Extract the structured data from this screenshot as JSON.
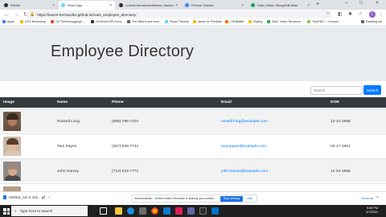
{
  "browser": {
    "tabs": [
      {
        "title": "GitHub",
        "color": "#24292e"
      },
      {
        "title": "React App",
        "color": "#61dafb"
      },
      {
        "title": "Lucidd-Hernandez/fitness_tracker",
        "color": "#24292e"
      },
      {
        "title": "Fitness Tracker",
        "color": "#4285f4"
      },
      {
        "title": "Data | Atlas: MongoDB Atlas",
        "color": "#13aa52"
      }
    ],
    "active_tab_index": 1,
    "new_tab_icon": "+",
    "url": "https://lusom-hernandez.github.io/react_employee_directory/",
    "bookmarks": [
      {
        "label": "Apps",
        "color": "#4285f4"
      },
      {
        "label": "UCF Bootcamp",
        "color": "#fbbc04"
      },
      {
        "label": "C# TheDebuggingC…",
        "color": "#ea4335"
      },
      {
        "label": "DevDocs API Docu…",
        "color": "#333333"
      },
      {
        "label": "The Why's and How…",
        "color": "#5f6368"
      },
      {
        "label": "React Tutorial",
        "color": "#61dafb"
      },
      {
        "label": "Ideas for Portfolio",
        "color": "#fbbc04"
      },
      {
        "label": "CSSBattle",
        "color": "#ff6d00"
      },
      {
        "label": "Styling",
        "color": "#fbbc04"
      },
      {
        "label": "WAC Video Structure",
        "color": "#34a853"
      },
      {
        "label": "TinyPNG – Compre…",
        "color": "#8bc34a"
      },
      {
        "label": "Reading list",
        "color": "#5f6368"
      }
    ],
    "profile_initial": "L"
  },
  "page": {
    "title": "Employee Directory",
    "search": {
      "placeholder": "Search",
      "value": ""
    },
    "search_button": "Search",
    "columns": [
      "Image",
      "Name",
      "Phone",
      "Email",
      "DOB"
    ],
    "employees": [
      {
        "name": "Russell Long",
        "phone": "(059)-785-7102",
        "email": "russell.long@example.com",
        "dob": "12-12-1958",
        "skin": "#b07a5e",
        "hair": "#3a2a1e",
        "shirt": "#6b4e3d"
      },
      {
        "name": "Tara Payne",
        "phone": "(267)-826-7744",
        "email": "tara.payne@example.com",
        "dob": "02-17-1961",
        "skin": "#e0b89a",
        "hair": "#5a3b2a",
        "shirt": "#d9c7b8"
      },
      {
        "name": "John Harvey",
        "phone": "(713)-524-7772",
        "email": "john.harvey@example.com",
        "dob": "12-24-1966",
        "skin": "#d9a88c",
        "hair": "#9c8b7c",
        "shirt": "#4a4a4a"
      }
    ]
  },
  "download_bar": {
    "file": "Untitled_Jun 9, 202....gif",
    "share_notice": "Screencastify – Screen Video Recorder is sharing your screen.",
    "stop_label": "Stop sharing",
    "hide_label": "Hide",
    "show_all": "Show all"
  },
  "taskbar": {
    "search_placeholder": "Type here to search",
    "time": "5:55 PM",
    "date": "6/7/2021",
    "apps": [
      {
        "name": "task-view",
        "color": "#ffffff"
      },
      {
        "name": "explorer",
        "color": "#f4c542"
      },
      {
        "name": "edge",
        "color": "#1f8fe0"
      },
      {
        "name": "store",
        "color": "#6b6b6b"
      },
      {
        "name": "mail",
        "color": "#0072c6"
      },
      {
        "name": "chrome",
        "color": "#fbbc04"
      },
      {
        "name": "vscode",
        "color": "#0b7ad1"
      },
      {
        "name": "slack",
        "color": "#e01e5a"
      },
      {
        "name": "teams",
        "color": "#6264a7"
      },
      {
        "name": "terminal",
        "color": "#2d2d2d"
      },
      {
        "name": "calculator",
        "color": "#444444"
      }
    ]
  }
}
